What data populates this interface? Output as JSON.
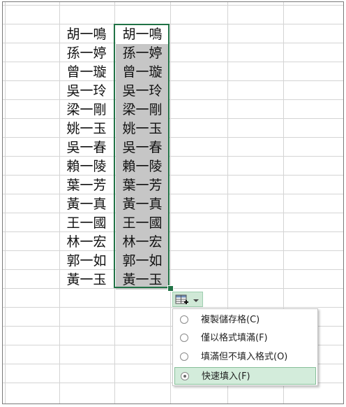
{
  "sheet": {
    "column_a": [
      "胡一鳴",
      "孫一婷",
      "曾一璇",
      "吳一玲",
      "梁一剛",
      "姚一玉",
      "吳一春",
      "賴一陵",
      "葉一芳",
      "黃一真",
      "王一國",
      "林一宏",
      "郭一如",
      "黃一玉"
    ],
    "column_b": [
      "胡一鳴",
      "孫一婷",
      "曾一璇",
      "吳一玲",
      "梁一剛",
      "姚一玉",
      "吳一春",
      "賴一陵",
      "葉一芳",
      "黃一真",
      "王一國",
      "林一宏",
      "郭一如",
      "黃一玉"
    ]
  },
  "smart_tag": {
    "icon": "flash-fill-options-icon",
    "arrow": "chevron-down-icon"
  },
  "menu": {
    "items": [
      {
        "label": "複製儲存格(C)",
        "checked": false
      },
      {
        "label": "僅以格式填滿(F)",
        "checked": false
      },
      {
        "label": "填滿但不填入格式(O)",
        "checked": false
      },
      {
        "label": "快速填入(F)",
        "checked": true
      }
    ]
  },
  "colors": {
    "selection_border": "#217346",
    "selection_fill": "#c6c6c6",
    "menu_highlight": "#d3ecdb"
  }
}
